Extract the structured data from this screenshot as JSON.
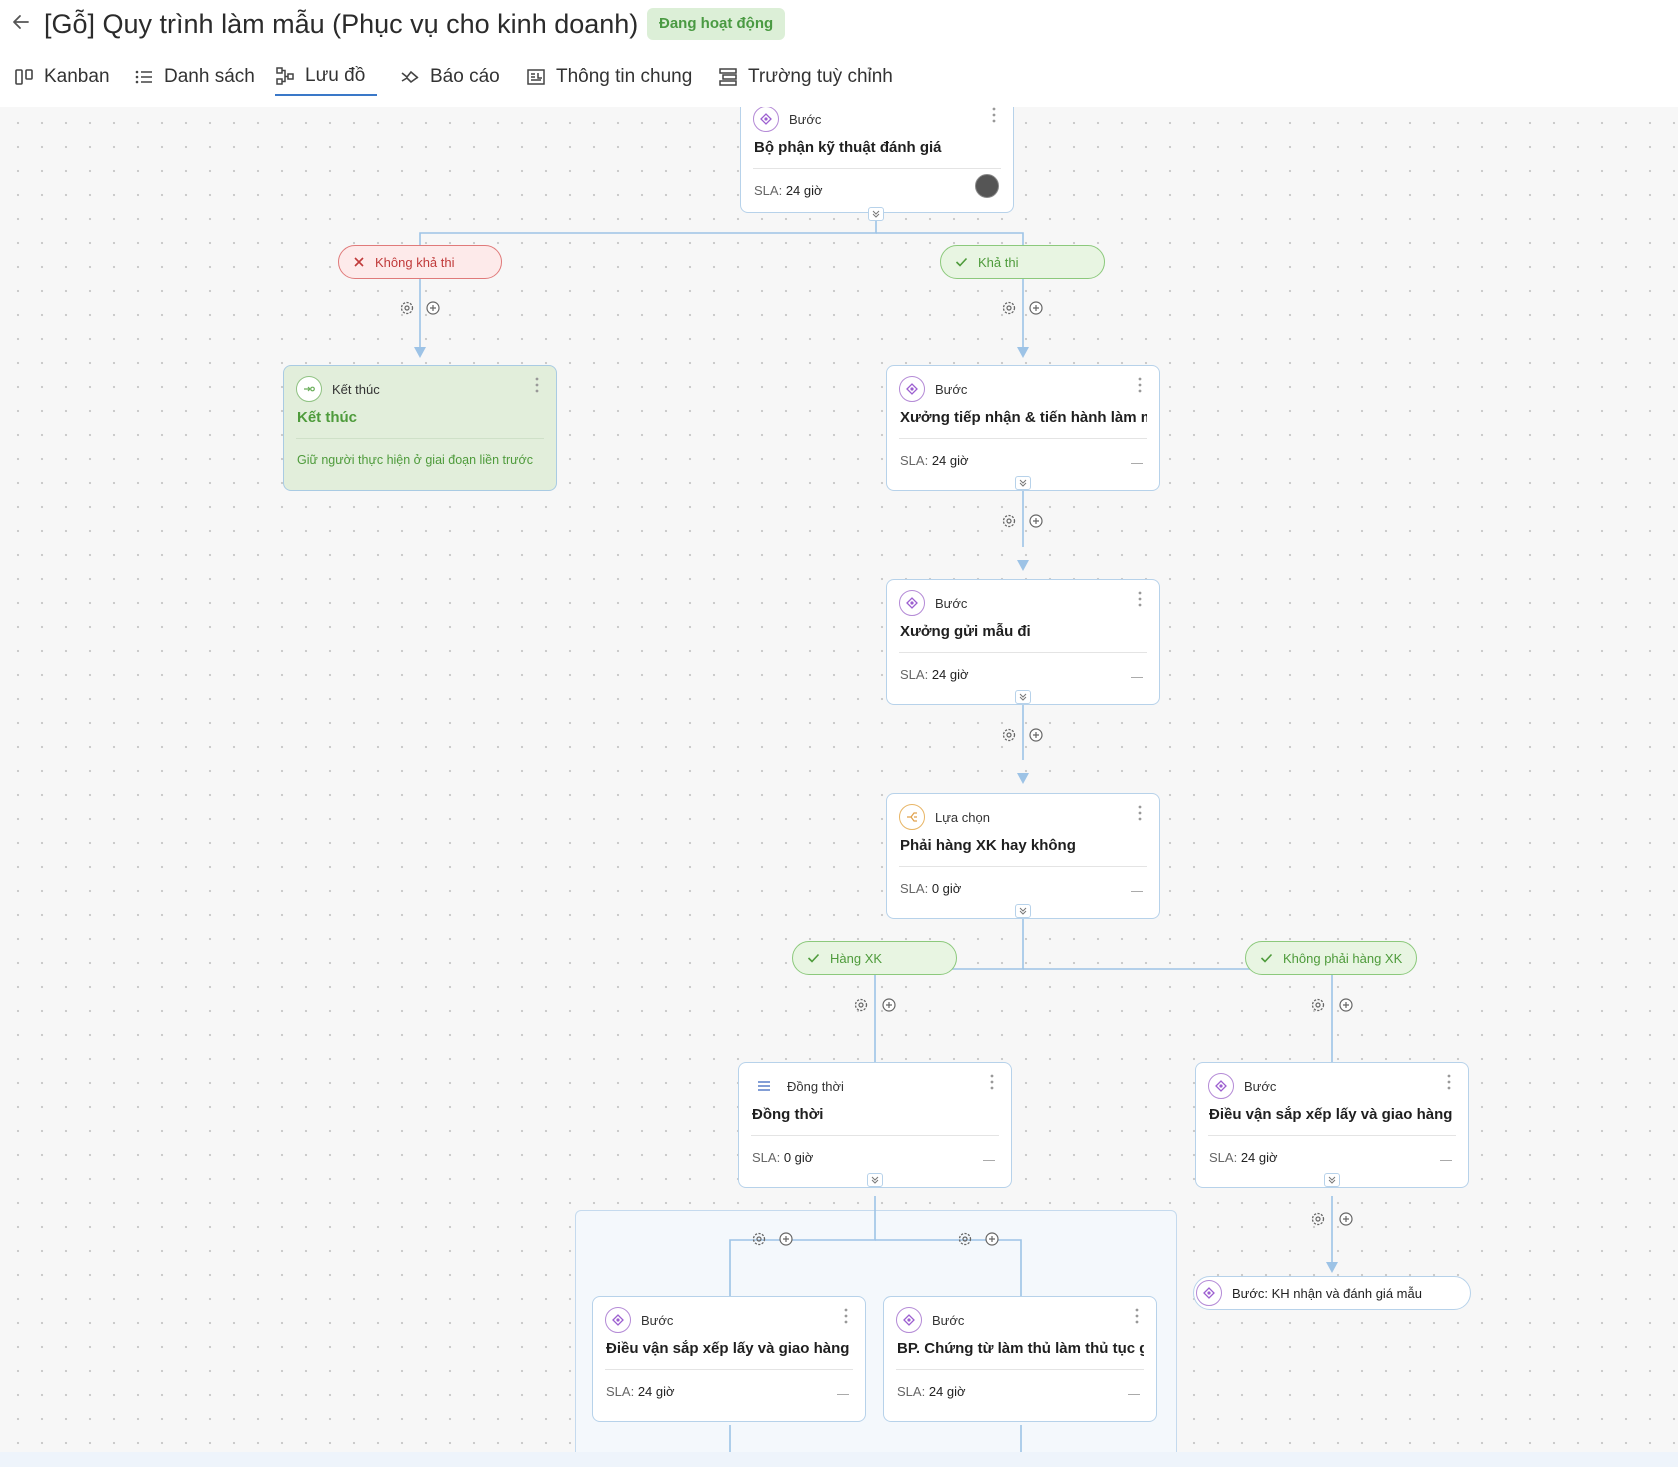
{
  "header": {
    "title": "[Gỗ] Quy trình làm mẫu (Phục vụ cho kinh doanh)",
    "status": "Đang hoạt động",
    "tabs": [
      {
        "label": "Kanban",
        "icon": "kanban-icon"
      },
      {
        "label": "Danh sách",
        "icon": "list-icon"
      },
      {
        "label": "Lưu đồ",
        "icon": "flowchart-icon",
        "active": true
      },
      {
        "label": "Báo cáo",
        "icon": "report-icon"
      },
      {
        "label": "Thông tin chung",
        "icon": "info-icon"
      },
      {
        "label": "Trường tuỳ chỉnh",
        "icon": "custom-fields-icon"
      }
    ]
  },
  "flow": {
    "sla_label": "SLA:",
    "nodes": {
      "n1": {
        "type": "Bước",
        "title": "Bộ phận kỹ thuật đánh giá",
        "sla": "24 giờ"
      },
      "end": {
        "type": "Kết thúc",
        "title": "Kết thúc",
        "note": "Giữ người thực hiện ở giai đoạn liền trước"
      },
      "n2": {
        "type": "Bước",
        "title": "Xưởng tiếp nhận & tiến hành làm m...",
        "sla": "24 giờ"
      },
      "n3": {
        "type": "Bước",
        "title": "Xưởng gửi mẫu đi",
        "sla": "24 giờ"
      },
      "n4": {
        "type": "Lựa chọn",
        "title": "Phải hàng XK hay không",
        "sla": "0 giờ"
      },
      "n5": {
        "type": "Đồng thời",
        "title": "Đồng thời",
        "sla": "0 giờ"
      },
      "n6": {
        "type": "Bước",
        "title": "Điều vận sắp xếp lấy và giao hàng",
        "sla": "24 giờ"
      },
      "n7": {
        "type": "Bước",
        "title": "Điều vận sắp xếp lấy và giao hàng",
        "sla": "24 giờ"
      },
      "n8": {
        "type": "Bước",
        "title": "BP. Chứng từ làm thủ làm thủ tục g...",
        "sla": "24 giờ"
      },
      "n9": {
        "label": "Bước: KH nhận và đánh giá mẫu"
      }
    },
    "branches": {
      "not_feasible": "Không khả thi",
      "feasible": "Khả thi",
      "export": "Hàng XK",
      "not_export": "Không phải hàng XK"
    }
  },
  "colors": {
    "accent": "#3a78c8",
    "status_bg": "#dcefd7",
    "status_text": "#4a9a42",
    "edge": "#9dc3e6"
  }
}
